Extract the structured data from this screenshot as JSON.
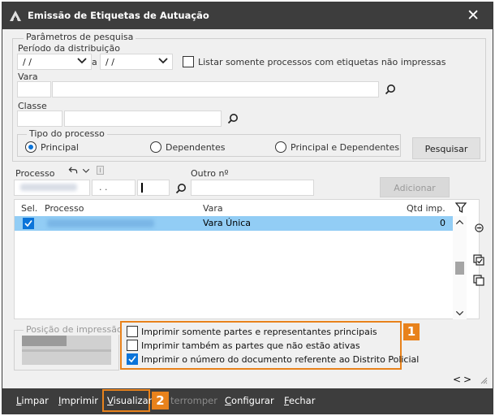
{
  "window": {
    "title": "Emissão de Etiquetas de Autuação"
  },
  "search_params": {
    "group_label": "Parâmetros de pesquisa",
    "period_label": "Período da distribuição",
    "date_from": "/ /",
    "date_separator": "a",
    "date_to": "/ /",
    "only_unprinted_label": "Listar somente processos com etiquetas não impressas",
    "vara_label": "Vara",
    "classe_label": "Classe",
    "tipo_group_label": "Tipo do processo",
    "tipo_options": [
      "Principal",
      "Dependentes",
      "Principal e Dependentes"
    ],
    "tipo_selected": "Principal",
    "search_button": "Pesquisar"
  },
  "processo_entry": {
    "processo_label": "Processo",
    "processo_mask": ". .",
    "outro_label": "Outro nº",
    "add_button": "Adicionar"
  },
  "grid": {
    "columns": [
      "Sel.",
      "Processo",
      "Vara",
      "Qtd imp."
    ],
    "rows": [
      {
        "selected": true,
        "vara": "Vara Única",
        "qtd": "0"
      }
    ]
  },
  "print_position": {
    "label": "Posição de impressão"
  },
  "print_options": [
    {
      "label": "Imprimir somente partes e representantes principais",
      "checked": false
    },
    {
      "label": "Imprimir também as partes que não estão ativas",
      "checked": false
    },
    {
      "label": "Imprimir o número do documento referente ao Distrito Policial",
      "checked": true
    }
  ],
  "pager": {
    "prev": "<",
    "next": ">"
  },
  "annotations": {
    "badge1": "1",
    "badge2": "2"
  },
  "bottom_menu": {
    "limpar_u": "L",
    "limpar_rest": "impar",
    "imprimir_u": "I",
    "imprimir_rest": "mprimir",
    "visualizar_u": "V",
    "visualizar_rest": "isualizar",
    "interromper_dim": "terromper",
    "configurar_u": "C",
    "configurar_rest": "onfigurar",
    "fechar_u": "F",
    "fechar_rest": "echar"
  },
  "colors": {
    "titlebar": "#3d3d3d",
    "accent": "#0b74d9",
    "selected_row": "#92cdf5",
    "highlight": "#e8821c"
  }
}
